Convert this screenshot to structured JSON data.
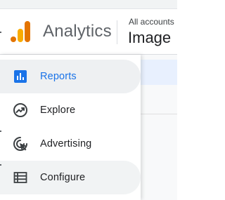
{
  "header": {
    "brand": "Analytics",
    "account_label": "All accounts",
    "property_name": "Image"
  },
  "nav": {
    "items": [
      {
        "label": "Reports",
        "icon": "bar-chart-icon",
        "selected": true
      },
      {
        "label": "Explore",
        "icon": "explore-trend-icon",
        "selected": false
      },
      {
        "label": "Advertising",
        "icon": "advertising-cursor-icon",
        "selected": false
      },
      {
        "label": "Configure",
        "icon": "list-table-icon",
        "selected": false
      }
    ]
  },
  "colors": {
    "accent": "#1a73e8",
    "logo_orange_dark": "#e37400",
    "logo_orange_light": "#f9ab00",
    "text_primary": "#202124",
    "text_secondary": "#5f6368",
    "hover_bg": "#f1f3f4"
  }
}
